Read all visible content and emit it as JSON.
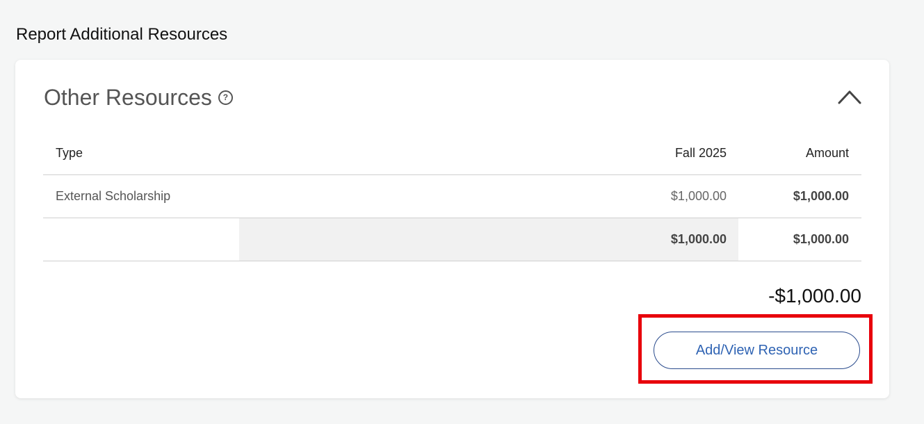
{
  "page": {
    "title": "Report Additional Resources"
  },
  "card": {
    "title": "Other Resources",
    "help_icon": "question-circle-icon",
    "toggle_icon": "chevron-up-icon"
  },
  "table": {
    "headers": {
      "type": "Type",
      "term": "Fall 2025",
      "amount": "Amount"
    },
    "rows": [
      {
        "type": "External Scholarship",
        "term": "$1,000.00",
        "amount": "$1,000.00"
      }
    ],
    "totals": {
      "term": "$1,000.00",
      "amount": "$1,000.00"
    }
  },
  "net_total": "-$1,000.00",
  "actions": {
    "add_view_label": "Add/View Resource"
  },
  "colors": {
    "accent": "#2f63b3",
    "highlight": "#e8000b",
    "background": "#f5f6f6"
  }
}
